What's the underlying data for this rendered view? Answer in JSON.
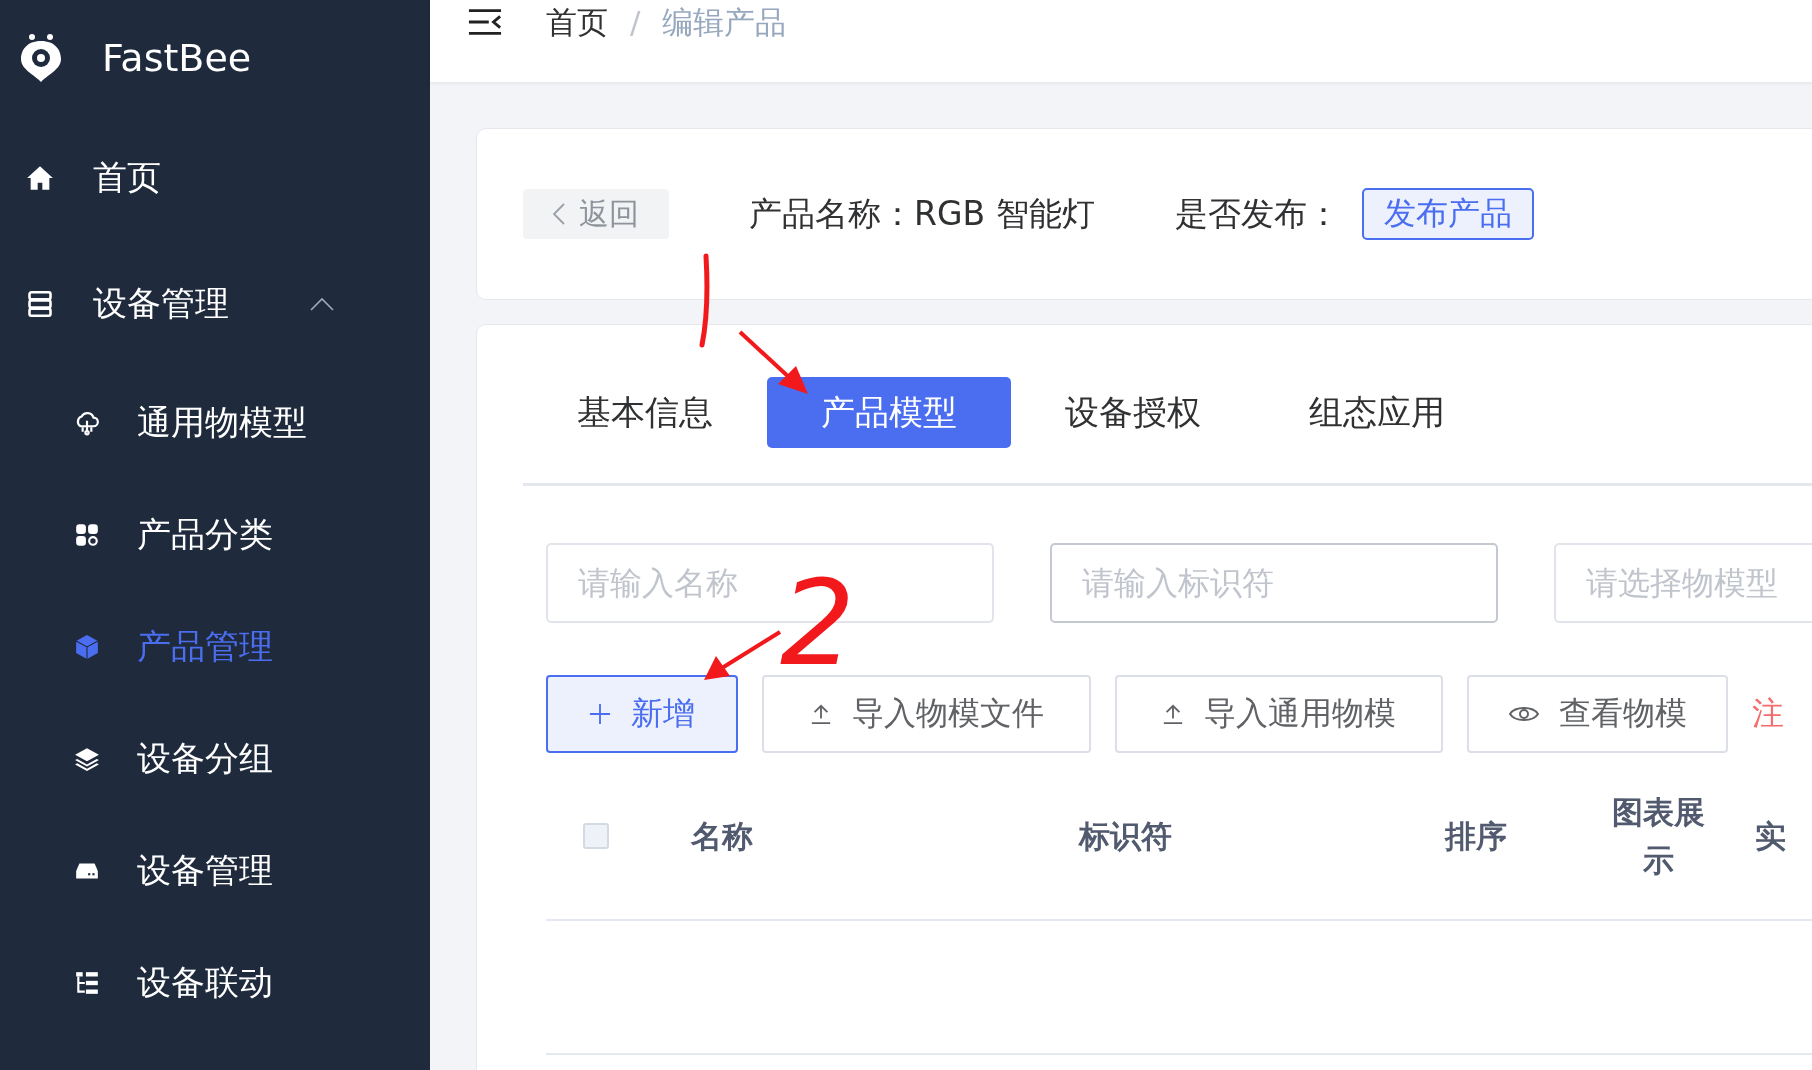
{
  "sidebar": {
    "logo": "FastBee",
    "items": [
      {
        "label": "首页",
        "selected": false
      },
      {
        "label": "设备管理",
        "selected": false,
        "expanded": true,
        "children": [
          {
            "label": "通用物模型",
            "selected": false
          },
          {
            "label": "产品分类",
            "selected": false
          },
          {
            "label": "产品管理",
            "selected": true
          },
          {
            "label": "设备分组",
            "selected": false
          },
          {
            "label": "设备管理",
            "selected": false
          },
          {
            "label": "设备联动",
            "selected": false
          }
        ]
      }
    ]
  },
  "header": {
    "breadcrumb": [
      {
        "label": "首页"
      },
      {
        "label": "编辑产品"
      }
    ],
    "separator": "/"
  },
  "product_bar": {
    "back_button": "返回",
    "name_text": "产品名称：RGB 智能灯",
    "publish_label": "是否发布：",
    "publish_button": "发布产品"
  },
  "tabs": [
    {
      "label": "基本信息",
      "selected": false
    },
    {
      "label": "产品模型",
      "selected": true
    },
    {
      "label": "设备授权",
      "selected": false
    },
    {
      "label": "组态应用",
      "selected": false
    }
  ],
  "filters": [
    {
      "placeholder": "请输入名称"
    },
    {
      "placeholder": "请输入标识符"
    },
    {
      "placeholder": "请选择物模型"
    }
  ],
  "toolbar": {
    "buttons": [
      {
        "kind": "primary",
        "label": "新增"
      },
      {
        "kind": "default",
        "label": "导入物模文件"
      },
      {
        "kind": "default",
        "label": "导入通用物模"
      },
      {
        "kind": "default",
        "label": "查看物模"
      }
    ],
    "notice": "注"
  },
  "table": {
    "select_all_checked": false,
    "columns": [
      "名称",
      "标识符",
      "排序",
      "图表展示",
      "实"
    ]
  },
  "annotations": {
    "number": "2"
  }
}
